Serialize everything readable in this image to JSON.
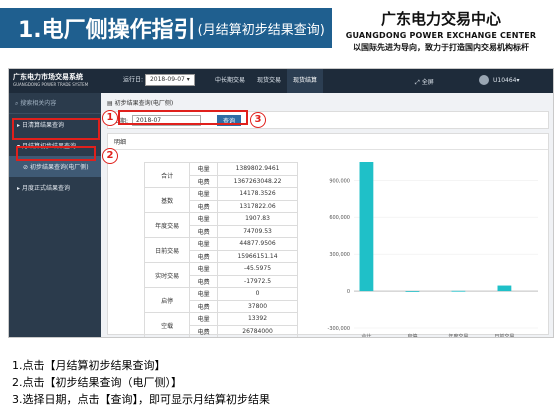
{
  "slide": {
    "title_main": "1.电厂侧操作指引",
    "title_sub": "(月结算初步结果查询)",
    "org_name_cn": "广东电力交易中心",
    "org_name_en": "GUANGDONG POWER EXCHANGE CENTER",
    "org_slogan": "以国际先进为导向，致力于打造国内交易机构标杆",
    "accent_color": "#1f5f8f",
    "highlight_color": "#e0201c"
  },
  "app": {
    "brand_cn": "广东电力市场交易系统",
    "brand_en": "GUANGDONG POWER TRADE SYSTEM",
    "period_label": "运行日:",
    "period_value": "2018-09-07",
    "nav_tabs": [
      "中长期交易",
      "现货交易",
      "现货结算"
    ],
    "fullscreen_label": "全屏",
    "user_label": "U10464",
    "sidebar": {
      "search_label": "搜索相关内容",
      "items": [
        "日清算结果查询",
        "月结算初步结果查询",
        "初步结果查询(电厂侧)",
        "月度正式结果查询"
      ]
    },
    "breadcrumb": "初步结果查询(电厂侧)",
    "date_label": "日期:",
    "date_value": "2018-07",
    "query_button": "查询",
    "panel_title": "明细",
    "table_rows": [
      [
        "合计",
        "电量",
        "1389802.9461"
      ],
      [
        "",
        "电费",
        "1367263048.22"
      ],
      [
        "基数",
        "电量",
        "14178.3526"
      ],
      [
        "",
        "电费",
        "1317822.06"
      ],
      [
        "年度交易",
        "电量",
        "1907.83"
      ],
      [
        "",
        "电费",
        "74709.53"
      ],
      [
        "日前交易",
        "电量",
        "44877.9506"
      ],
      [
        "",
        "电费",
        "15966151.14"
      ],
      [
        "实时交易",
        "电量",
        "-45.5975"
      ],
      [
        "",
        "电费",
        "-17972.5"
      ],
      [
        "启停",
        "电量",
        "0"
      ],
      [
        "",
        "电费",
        "37800"
      ],
      [
        "空载",
        "电量",
        "13392"
      ],
      [
        "",
        "电费",
        "26784000"
      ]
    ]
  },
  "annotations": {
    "step1": "1",
    "step2": "2",
    "step3": "3"
  },
  "instructions": [
    "1.点击【月结算初步结果查询】",
    "2.点击【初步结果查询（电厂侧）】",
    "3.选择日期，点击【查询】，即可显示月结算初步结果"
  ],
  "chart_data": {
    "type": "bar",
    "categories": [
      "合计",
      "启停",
      "年度交易",
      "日前交易"
    ],
    "values": [
      1389802.9461,
      0,
      1907.83,
      44877.9506
    ],
    "yticks": [
      900000,
      600000,
      300000,
      0,
      -300000
    ],
    "ylim": [
      -300000,
      1000000
    ],
    "title": "",
    "xlabel": "",
    "ylabel": "",
    "bar_color": "#1fc0c8"
  }
}
